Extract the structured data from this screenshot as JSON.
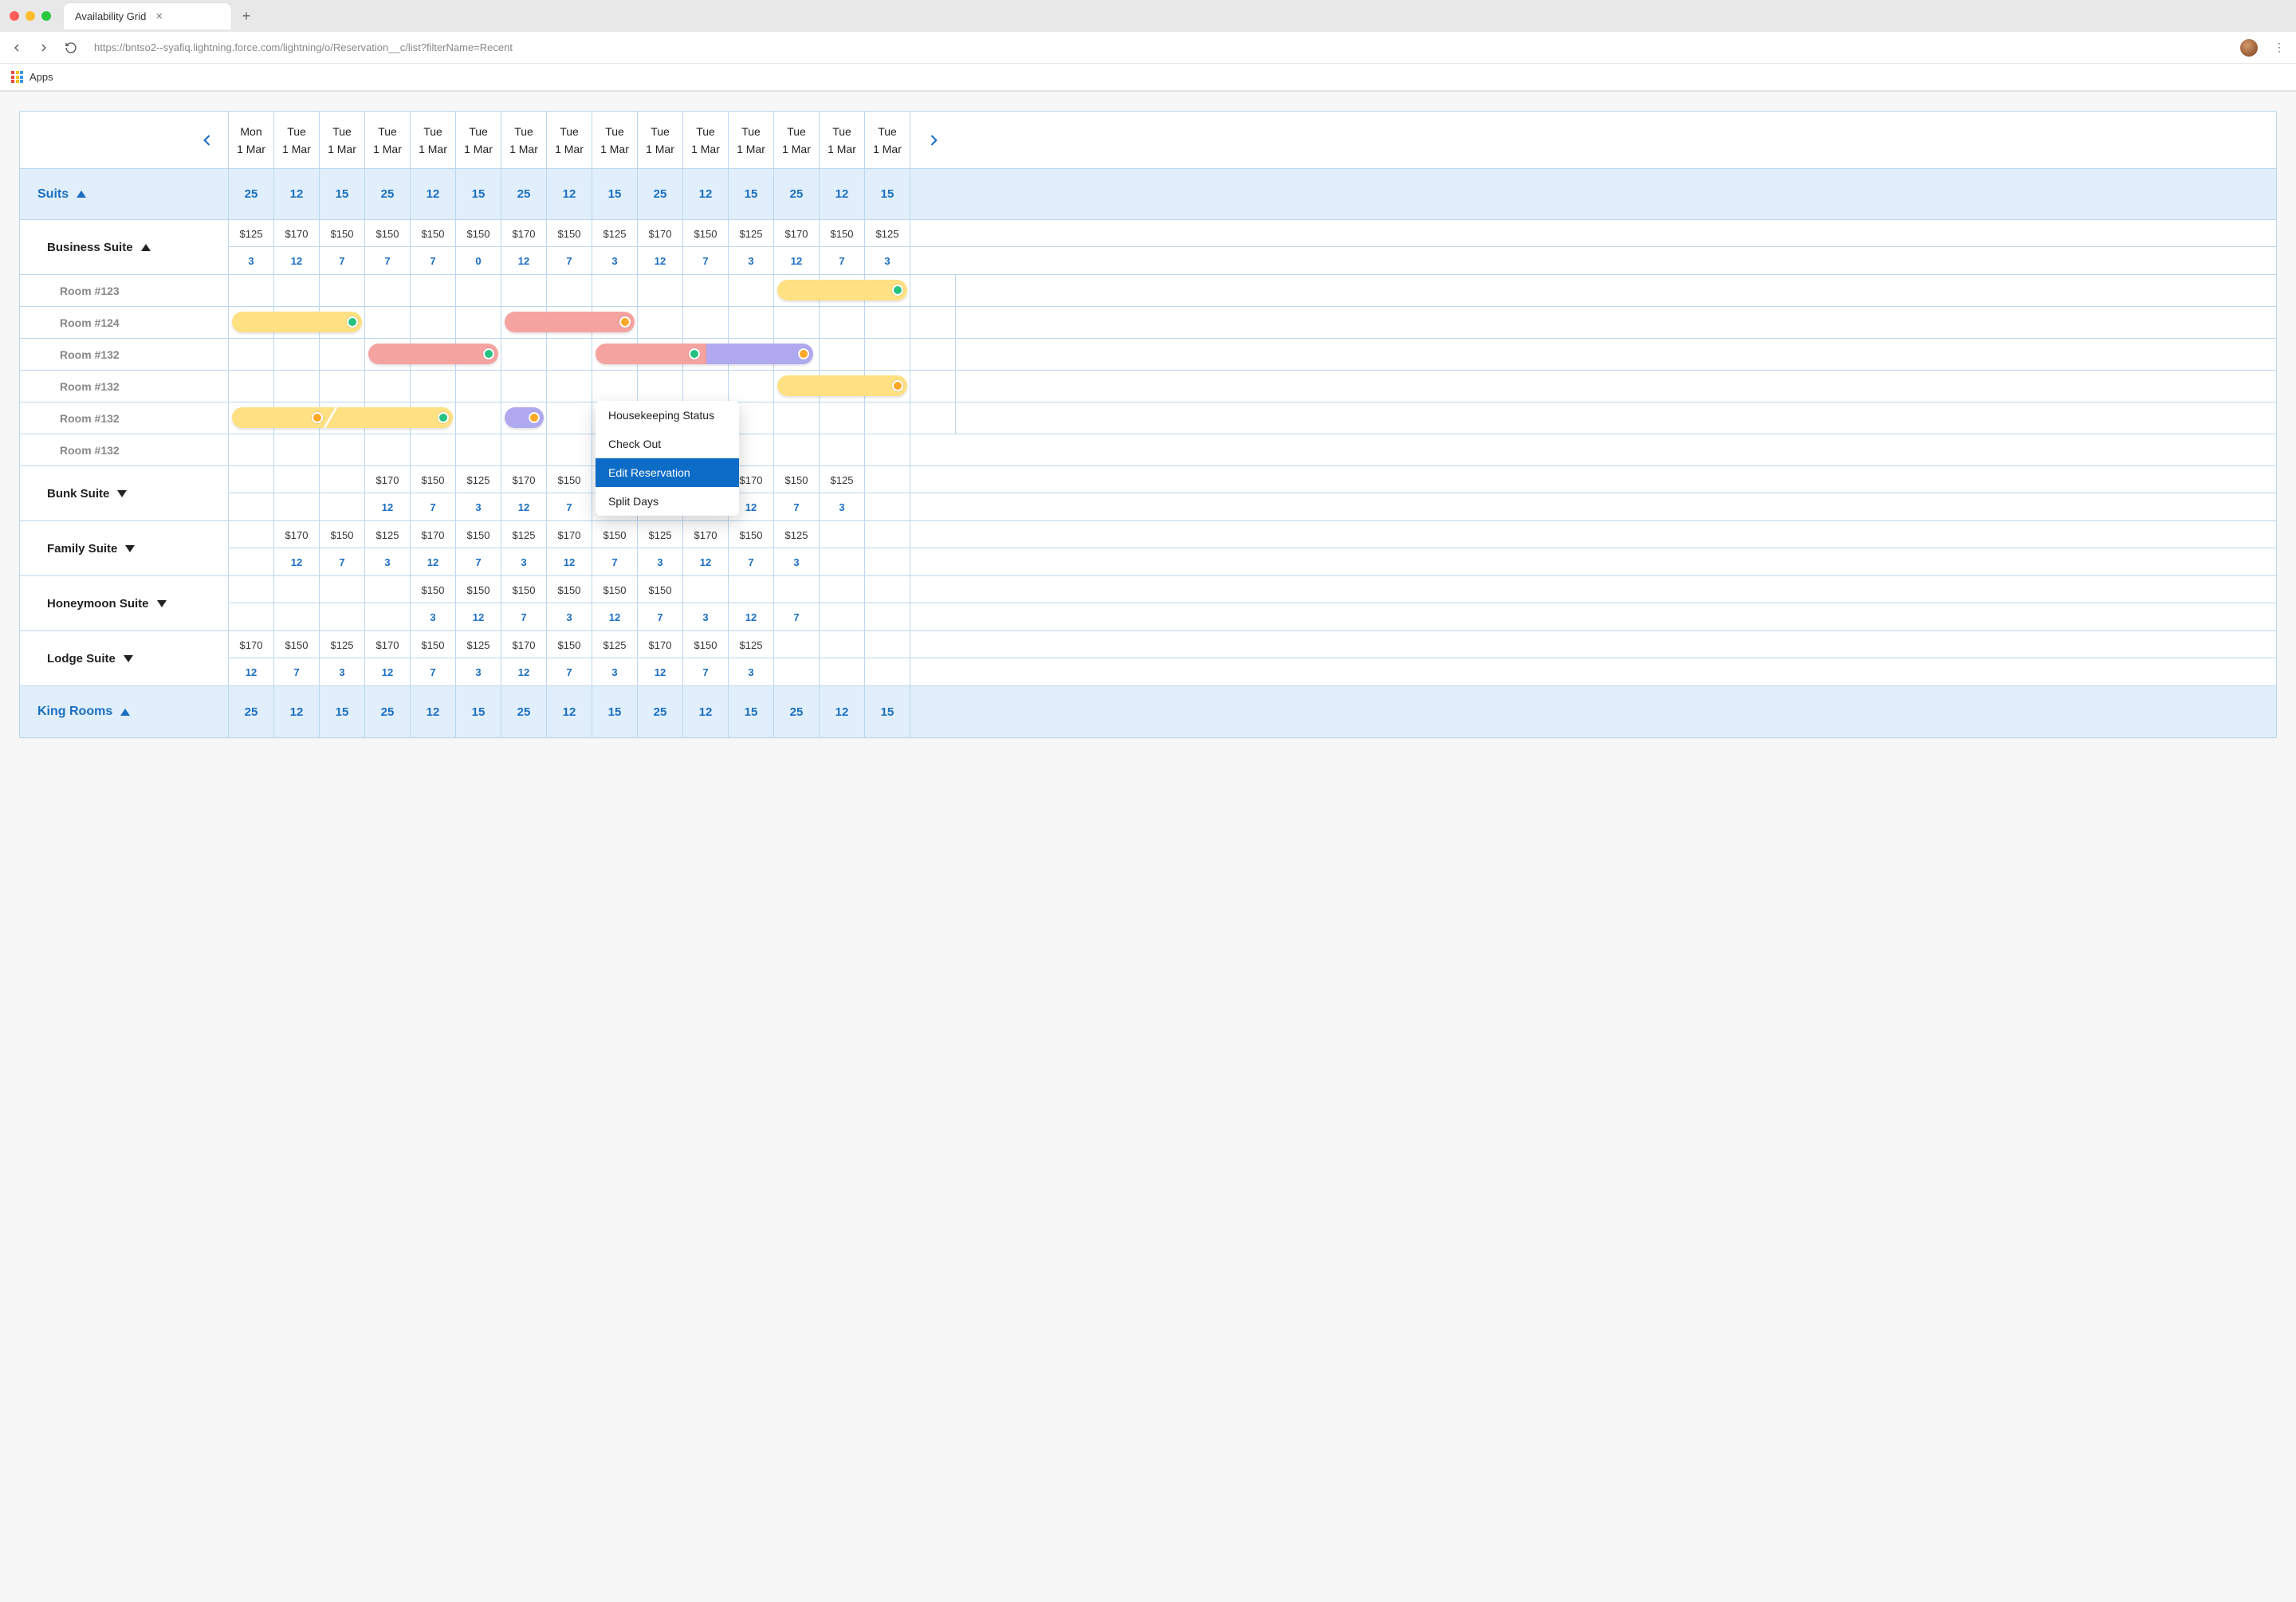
{
  "browser": {
    "tab_title": "Availability Grid",
    "url": "https://bntso2--syafiq.lightning.force.com/lightning/o/Reservation__c/list?filterName=Recent",
    "bookmark_apps": "Apps"
  },
  "grid": {
    "columns": [
      {
        "day": "Mon",
        "date": "1 Mar"
      },
      {
        "day": "Tue",
        "date": "1 Mar"
      },
      {
        "day": "Tue",
        "date": "1 Mar"
      },
      {
        "day": "Tue",
        "date": "1 Mar"
      },
      {
        "day": "Tue",
        "date": "1 Mar"
      },
      {
        "day": "Tue",
        "date": "1 Mar"
      },
      {
        "day": "Tue",
        "date": "1 Mar"
      },
      {
        "day": "Tue",
        "date": "1 Mar"
      },
      {
        "day": "Tue",
        "date": "1 Mar"
      },
      {
        "day": "Tue",
        "date": "1 Mar"
      },
      {
        "day": "Tue",
        "date": "1 Mar"
      },
      {
        "day": "Tue",
        "date": "1 Mar"
      },
      {
        "day": "Tue",
        "date": "1 Mar"
      },
      {
        "day": "Tue",
        "date": "1 Mar"
      },
      {
        "day": "Tue",
        "date": "1 Mar"
      },
      {
        "day": "Tue",
        "date": "1 Mar"
      }
    ],
    "section_suits": {
      "label": "Suits",
      "counts": [
        "25",
        "12",
        "15",
        "25",
        "12",
        "15",
        "25",
        "12",
        "15",
        "25",
        "12",
        "15",
        "25",
        "12",
        "15",
        ""
      ]
    },
    "business_suite": {
      "label": "Business Suite",
      "prices": [
        "$125",
        "$170",
        "$150",
        "$150",
        "$150",
        "$150",
        "$170",
        "$150",
        "$125",
        "$170",
        "$150",
        "$125",
        "$170",
        "$150",
        "$125",
        ""
      ],
      "counts": [
        "3",
        "12",
        "7",
        "7",
        "7",
        "0",
        "12",
        "7",
        "3",
        "12",
        "7",
        "3",
        "12",
        "7",
        "3",
        ""
      ]
    },
    "rooms": [
      {
        "label": "Room  #123"
      },
      {
        "label": "Room  #124"
      },
      {
        "label": "Room  #132"
      },
      {
        "label": "Room  #132"
      },
      {
        "label": "Room  #132"
      },
      {
        "label": "Room  #132"
      }
    ],
    "bunk_suite": {
      "label": "Bunk Suite",
      "prices": [
        "",
        "",
        "",
        "$170",
        "$150",
        "$125",
        "$170",
        "$150",
        "",
        "",
        "$125",
        "$170",
        "$150",
        "$125",
        ""
      ],
      "counts": [
        "",
        "",
        "",
        "12",
        "7",
        "3",
        "12",
        "7",
        "",
        "",
        "3",
        "12",
        "7",
        "3",
        ""
      ]
    },
    "family_suite": {
      "label": "Family Suite",
      "prices": [
        "",
        "$170",
        "$150",
        "$125",
        "$170",
        "$150",
        "$125",
        "$170",
        "$150",
        "$125",
        "$170",
        "$150",
        "$125",
        "",
        "",
        ""
      ],
      "counts": [
        "",
        "12",
        "7",
        "3",
        "12",
        "7",
        "3",
        "12",
        "7",
        "3",
        "12",
        "7",
        "3",
        "",
        "",
        ""
      ]
    },
    "honeymoon_suite": {
      "label": "Honeymoon Suite",
      "prices": [
        "",
        "",
        "",
        "",
        "$150",
        "$150",
        "$150",
        "$150",
        "$150",
        "$150",
        "",
        "",
        "",
        "",
        "",
        ""
      ],
      "counts": [
        "",
        "",
        "",
        "",
        "3",
        "12",
        "7",
        "3",
        "12",
        "7",
        "3",
        "12",
        "7",
        "",
        "",
        ""
      ]
    },
    "lodge_suite": {
      "label": "Lodge Suite",
      "prices": [
        "$170",
        "$150",
        "$125",
        "$170",
        "$150",
        "$125",
        "$170",
        "$150",
        "$125",
        "$170",
        "$150",
        "$125",
        "",
        "",
        "",
        ""
      ],
      "counts": [
        "12",
        "7",
        "3",
        "12",
        "7",
        "3",
        "12",
        "7",
        "3",
        "12",
        "7",
        "3",
        "",
        "",
        "",
        ""
      ]
    },
    "section_king": {
      "label": "King Rooms",
      "counts": [
        "25",
        "12",
        "15",
        "25",
        "12",
        "15",
        "25",
        "12",
        "15",
        "25",
        "12",
        "15",
        "25",
        "12",
        "15",
        ""
      ]
    }
  },
  "context_menu": {
    "items": [
      "Housekeeping Status",
      "Check Out",
      "Edit Reservation",
      "Split Days"
    ]
  }
}
